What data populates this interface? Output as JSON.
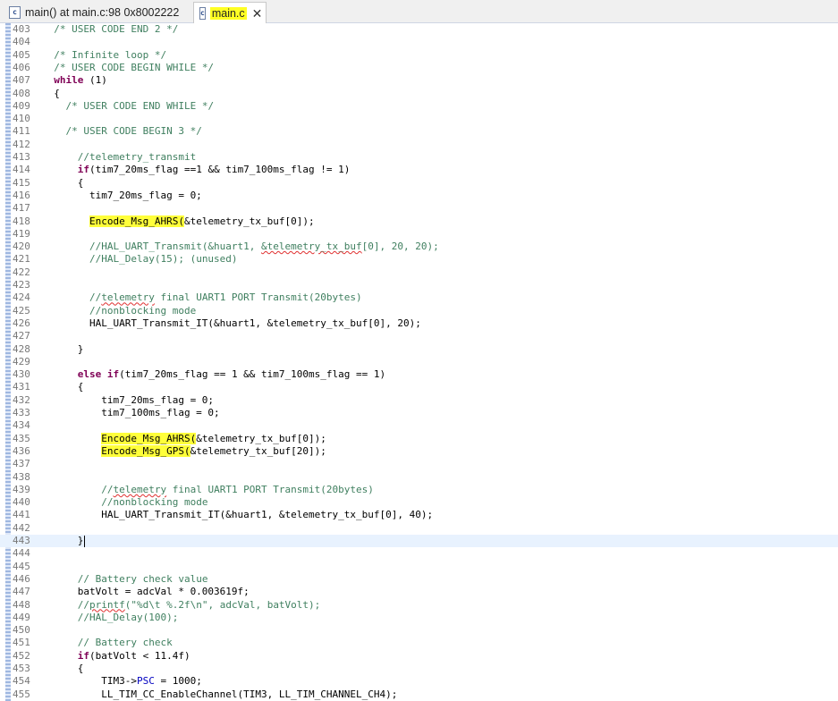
{
  "tabs": [
    {
      "label": "main() at main.c:98 0x8002222",
      "icon": "c-file-icon",
      "active": false
    },
    {
      "label": "main.c",
      "icon": "c-file-icon",
      "active": true
    }
  ],
  "colors": {
    "highlight": "#ffff3a",
    "comment": "#3f7f5f",
    "keyword": "#7f0055",
    "field": "#0000c0",
    "current_line": "#e8f2fe"
  },
  "editor": {
    "current_line": "443",
    "lines": [
      {
        "n": "403",
        "segs": [
          {
            "t": "  "
          },
          {
            "t": "/* USER CODE END 2 */",
            "c": "cm"
          }
        ]
      },
      {
        "n": "404",
        "segs": []
      },
      {
        "n": "405",
        "segs": [
          {
            "t": "  "
          },
          {
            "t": "/* Infinite loop */",
            "c": "cm"
          }
        ]
      },
      {
        "n": "406",
        "segs": [
          {
            "t": "  "
          },
          {
            "t": "/* USER CODE BEGIN WHILE */",
            "c": "cm"
          }
        ]
      },
      {
        "n": "407",
        "segs": [
          {
            "t": "  "
          },
          {
            "t": "while",
            "c": "kw"
          },
          {
            "t": " (1)"
          }
        ]
      },
      {
        "n": "408",
        "segs": [
          {
            "t": "  {"
          }
        ]
      },
      {
        "n": "409",
        "segs": [
          {
            "t": "    "
          },
          {
            "t": "/* USER CODE END WHILE */",
            "c": "cm"
          }
        ]
      },
      {
        "n": "410",
        "segs": []
      },
      {
        "n": "411",
        "segs": [
          {
            "t": "    "
          },
          {
            "t": "/* USER CODE BEGIN 3 */",
            "c": "cm"
          }
        ]
      },
      {
        "n": "412",
        "segs": []
      },
      {
        "n": "413",
        "segs": [
          {
            "t": "      "
          },
          {
            "t": "//telemetry_transmit",
            "c": "cm"
          }
        ]
      },
      {
        "n": "414",
        "segs": [
          {
            "t": "      "
          },
          {
            "t": "if",
            "c": "kw"
          },
          {
            "t": "(tim7_20ms_flag ==1 && tim7_100ms_flag != 1)"
          }
        ]
      },
      {
        "n": "415",
        "segs": [
          {
            "t": "      {"
          }
        ]
      },
      {
        "n": "416",
        "segs": [
          {
            "t": "        tim7_20ms_flag = 0;"
          }
        ]
      },
      {
        "n": "417",
        "segs": []
      },
      {
        "n": "418",
        "segs": [
          {
            "t": "        "
          },
          {
            "t": "Encode_Msg_AHRS(",
            "c": "hl"
          },
          {
            "t": "&telemetry_tx_buf[0]);"
          }
        ]
      },
      {
        "n": "419",
        "segs": []
      },
      {
        "n": "420",
        "segs": [
          {
            "t": "        "
          },
          {
            "t": "//HAL_UART_Transmit(&huart1, ",
            "c": "cm"
          },
          {
            "t": "&telemetry_tx_buf",
            "c": "cm squig"
          },
          {
            "t": "[0], 20, 20);",
            "c": "cm"
          }
        ]
      },
      {
        "n": "421",
        "segs": [
          {
            "t": "        "
          },
          {
            "t": "//HAL_Delay(15); (unused)",
            "c": "cm"
          }
        ]
      },
      {
        "n": "422",
        "segs": []
      },
      {
        "n": "423",
        "segs": []
      },
      {
        "n": "424",
        "segs": [
          {
            "t": "        "
          },
          {
            "t": "//",
            "c": "cm"
          },
          {
            "t": "telemetry",
            "c": "cm squig"
          },
          {
            "t": " final UART1 PORT Transmit(20bytes)",
            "c": "cm"
          }
        ]
      },
      {
        "n": "425",
        "segs": [
          {
            "t": "        "
          },
          {
            "t": "//nonblocking mode",
            "c": "cm"
          }
        ]
      },
      {
        "n": "426",
        "segs": [
          {
            "t": "        HAL_UART_Transmit_IT(&huart1, &telemetry_tx_buf[0], 20);"
          }
        ]
      },
      {
        "n": "427",
        "segs": []
      },
      {
        "n": "428",
        "segs": [
          {
            "t": "      }"
          }
        ]
      },
      {
        "n": "429",
        "segs": []
      },
      {
        "n": "430",
        "segs": [
          {
            "t": "      "
          },
          {
            "t": "else if",
            "c": "kw"
          },
          {
            "t": "(tim7_20ms_flag == 1 && tim7_100ms_flag == 1)"
          }
        ]
      },
      {
        "n": "431",
        "segs": [
          {
            "t": "      {"
          }
        ]
      },
      {
        "n": "432",
        "segs": [
          {
            "t": "          tim7_20ms_flag = 0;"
          }
        ]
      },
      {
        "n": "433",
        "segs": [
          {
            "t": "          tim7_100ms_flag = 0;"
          }
        ]
      },
      {
        "n": "434",
        "segs": []
      },
      {
        "n": "435",
        "segs": [
          {
            "t": "          "
          },
          {
            "t": "Encode_Msg_AHRS(",
            "c": "hl"
          },
          {
            "t": "&telemetry_tx_buf[0]);"
          }
        ]
      },
      {
        "n": "436",
        "segs": [
          {
            "t": "          "
          },
          {
            "t": "Encode_Msg_GPS(",
            "c": "hl"
          },
          {
            "t": "&telemetry_tx_buf[20]);"
          }
        ]
      },
      {
        "n": "437",
        "segs": []
      },
      {
        "n": "438",
        "segs": []
      },
      {
        "n": "439",
        "segs": [
          {
            "t": "          "
          },
          {
            "t": "//",
            "c": "cm"
          },
          {
            "t": "telemetry",
            "c": "cm squig"
          },
          {
            "t": " final UART1 PORT Transmit(20bytes)",
            "c": "cm"
          }
        ]
      },
      {
        "n": "440",
        "segs": [
          {
            "t": "          "
          },
          {
            "t": "//nonblocking mode",
            "c": "cm"
          }
        ]
      },
      {
        "n": "441",
        "segs": [
          {
            "t": "          HAL_UART_Transmit_IT(&huart1, &telemetry_tx_buf[0], 40);"
          }
        ]
      },
      {
        "n": "442",
        "segs": []
      },
      {
        "n": "443",
        "segs": [
          {
            "t": "      }"
          }
        ]
      },
      {
        "n": "444",
        "segs": []
      },
      {
        "n": "445",
        "segs": []
      },
      {
        "n": "446",
        "segs": [
          {
            "t": "      "
          },
          {
            "t": "// Battery check value",
            "c": "cm"
          }
        ]
      },
      {
        "n": "447",
        "segs": [
          {
            "t": "      batVolt = adcVal * 0.003619f;"
          }
        ]
      },
      {
        "n": "448",
        "segs": [
          {
            "t": "      "
          },
          {
            "t": "//",
            "c": "cm"
          },
          {
            "t": "printf",
            "c": "cm squig"
          },
          {
            "t": "(\"%d\\t %.2f\\n\", adcVal, batVolt);",
            "c": "cm"
          }
        ]
      },
      {
        "n": "449",
        "segs": [
          {
            "t": "      "
          },
          {
            "t": "//HAL_Delay(100);",
            "c": "cm"
          }
        ]
      },
      {
        "n": "450",
        "segs": []
      },
      {
        "n": "451",
        "segs": [
          {
            "t": "      "
          },
          {
            "t": "// Battery check",
            "c": "cm"
          }
        ]
      },
      {
        "n": "452",
        "segs": [
          {
            "t": "      "
          },
          {
            "t": "if",
            "c": "kw"
          },
          {
            "t": "(batVolt < 11.4f)"
          }
        ]
      },
      {
        "n": "453",
        "segs": [
          {
            "t": "      {"
          }
        ]
      },
      {
        "n": "454",
        "segs": [
          {
            "t": "          TIM3->"
          },
          {
            "t": "PSC",
            "c": "fld"
          },
          {
            "t": " = 1000;"
          }
        ]
      },
      {
        "n": "455",
        "segs": [
          {
            "t": "          LL_TIM_CC_EnableChannel(TIM3, LL_TIM_CHANNEL_CH4);"
          }
        ]
      }
    ]
  }
}
